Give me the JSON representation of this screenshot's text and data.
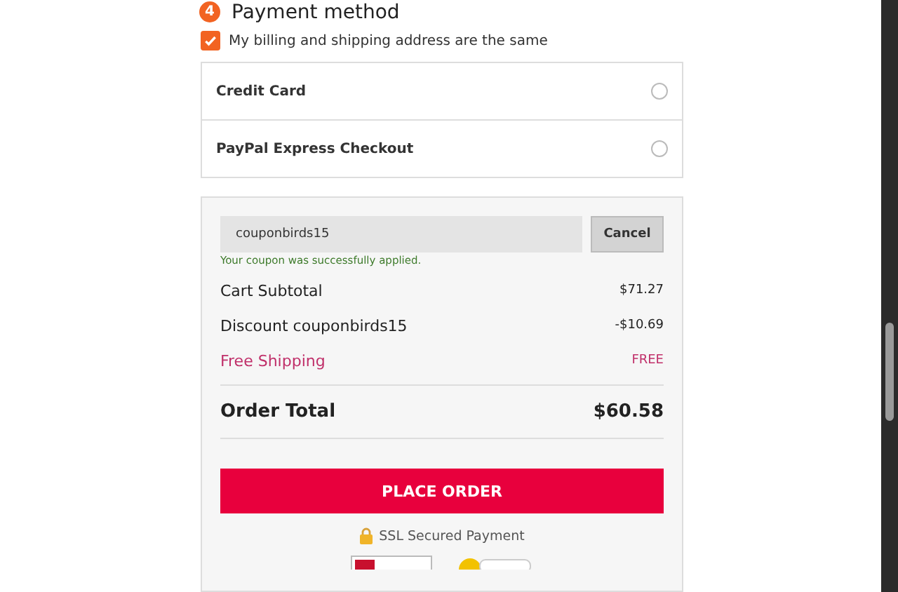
{
  "step": {
    "number": "4",
    "title": "Payment method"
  },
  "same_address": {
    "label": "My billing and shipping address are the same",
    "checked": true
  },
  "payment_methods": [
    {
      "label": "Credit Card",
      "selected": false
    },
    {
      "label": "PayPal Express Checkout",
      "selected": false
    }
  ],
  "coupon": {
    "value": "couponbirds15",
    "button": "Cancel",
    "message": "Your coupon was successfully applied."
  },
  "totals": [
    {
      "label": "Cart Subtotal",
      "value": "$71.27",
      "kind": "normal"
    },
    {
      "label": "Discount couponbirds15",
      "value": "-$10.69",
      "kind": "normal"
    },
    {
      "label": "Free Shipping",
      "value": "FREE",
      "kind": "highlight"
    }
  ],
  "order_total": {
    "label": "Order Total",
    "value": "$60.58"
  },
  "place_order": "PLACE ORDER",
  "secure_note": "SSL Secured Payment"
}
